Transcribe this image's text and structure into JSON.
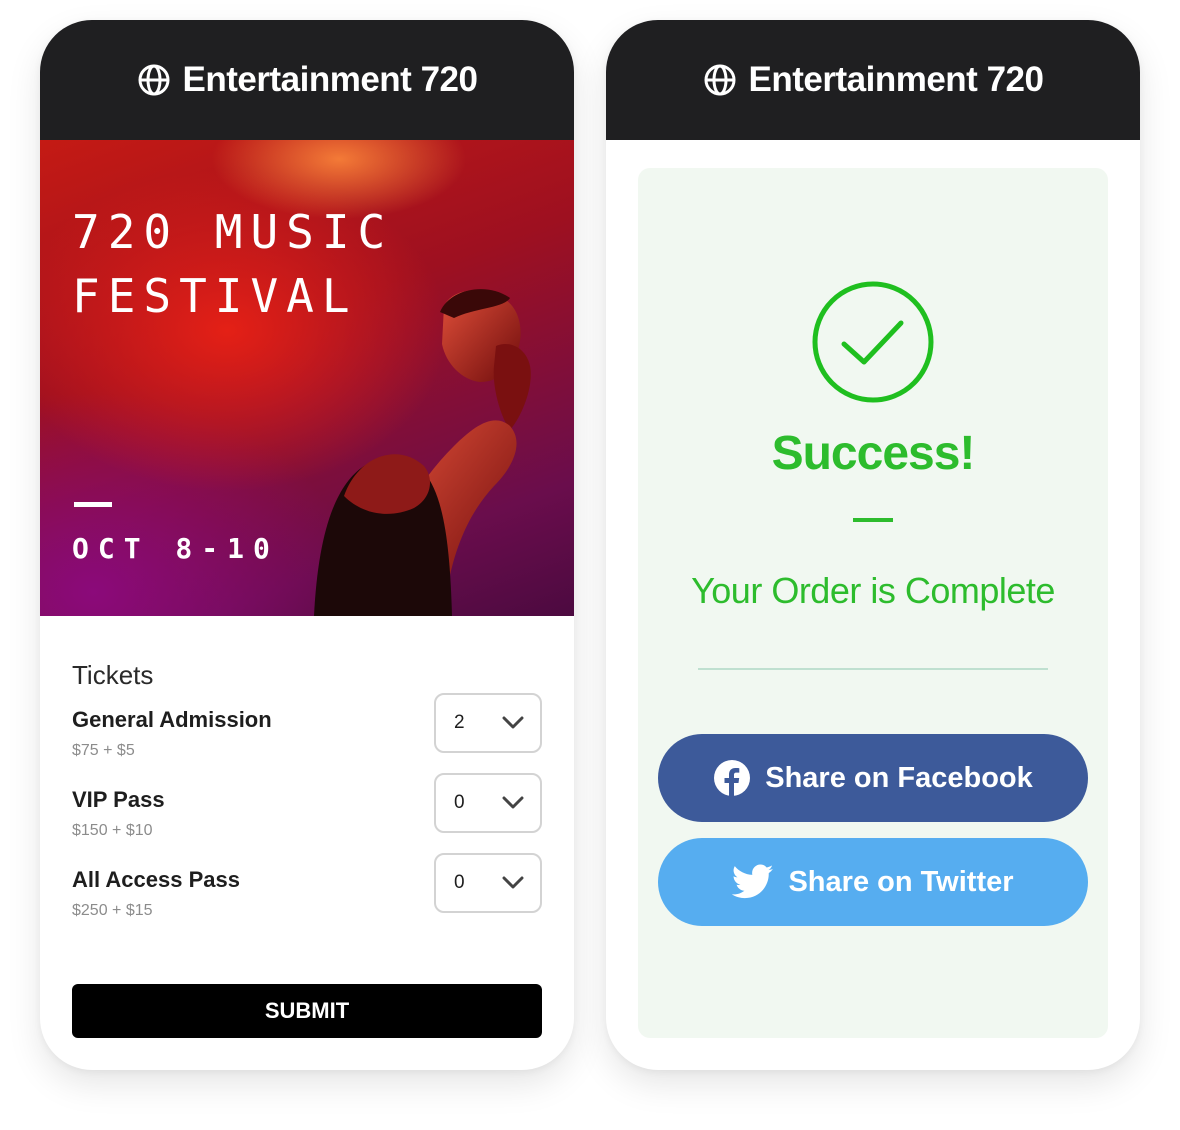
{
  "left_card": {
    "header": {
      "title": "Entertainment 720",
      "icon": "globe-icon"
    },
    "hero": {
      "title": "720 MUSIC\nFESTIVAL",
      "date": "OCT 8-10"
    },
    "tickets": {
      "heading": "Tickets",
      "items": [
        {
          "name": "General Admission",
          "price": "$75 + $5",
          "quantity": "2"
        },
        {
          "name": "VIP Pass",
          "price": "$150 + $10",
          "quantity": "0"
        },
        {
          "name": "All Access Pass",
          "price": "$250 + $15",
          "quantity": "0"
        }
      ]
    },
    "submit_label": "SUBMIT"
  },
  "right_card": {
    "header": {
      "title": "Entertainment 720",
      "icon": "globe-icon"
    },
    "success": {
      "icon": "check-circle-icon",
      "title": "Success!",
      "message": "Your Order is Complete"
    },
    "share": {
      "facebook_label": "Share on Facebook",
      "twitter_label": "Share on Twitter"
    }
  },
  "colors": {
    "header_bg": "#1f1f21",
    "success_green": "#2dbc2d",
    "facebook_blue": "#3d5a9a",
    "twitter_blue": "#56adf0",
    "panel_bg": "#f1f8f1"
  }
}
